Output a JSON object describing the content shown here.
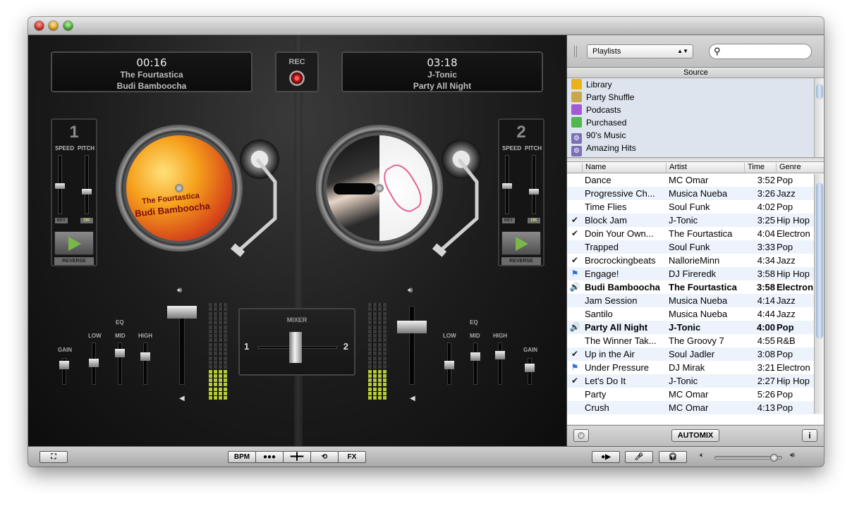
{
  "deck1": {
    "time": "00:16",
    "artist": "The Fourtastica",
    "title": "Budi Bamboocha",
    "number": "1",
    "label_line1": "The Fourtastica",
    "label_line2": "Budi Bamboocha"
  },
  "deck2": {
    "time": "03:18",
    "artist": "J-Tonic",
    "title": "Party All Night",
    "number": "2"
  },
  "rec_label": "REC",
  "deck_controls": {
    "speed": "SPEED",
    "pitch": "PITCH",
    "key": "KEY",
    "ok": "OK",
    "reverse": "REVERSE"
  },
  "eq": {
    "title": "EQ",
    "low": "LOW",
    "mid": "MID",
    "high": "HIGH",
    "gain": "GAIN"
  },
  "mixer": {
    "title": "MIXER",
    "left": "1",
    "right": "2"
  },
  "sidebar": {
    "source_select": "Playlists",
    "source_header": "Source",
    "sources": [
      {
        "label": "Library",
        "icon": "library-icon",
        "color": "#e8b21c"
      },
      {
        "label": "Party Shuffle",
        "icon": "party-shuffle-icon",
        "color": "#c9a84a"
      },
      {
        "label": "Podcasts",
        "icon": "podcasts-icon",
        "color": "#a35ad6"
      },
      {
        "label": "Purchased",
        "icon": "purchased-icon",
        "color": "#4fb84f"
      },
      {
        "label": "90’s Music",
        "icon": "smart-playlist-icon",
        "color": "#7a6fb8"
      },
      {
        "label": "Amazing Hits",
        "icon": "smart-playlist-icon",
        "color": "#7a6fb8"
      }
    ],
    "columns": {
      "name": "Name",
      "artist": "Artist",
      "time": "Time",
      "genre": "Genre"
    },
    "rows": [
      {
        "mark": "",
        "name": "Dance",
        "artist": "MC Omar",
        "time": "3:52",
        "genre": "Pop"
      },
      {
        "mark": "",
        "name": "Progressive Ch...",
        "artist": "Musica Nueba",
        "time": "3:26",
        "genre": "Jazz"
      },
      {
        "mark": "",
        "name": "Time Flies",
        "artist": "Soul Funk",
        "time": "4:02",
        "genre": "Pop"
      },
      {
        "mark": "✔",
        "name": "Block Jam",
        "artist": "J-Tonic",
        "time": "3:25",
        "genre": "Hip Hop"
      },
      {
        "mark": "✔",
        "name": "Doin Your Own...",
        "artist": "The Fourtastica",
        "time": "4:04",
        "genre": "Electron"
      },
      {
        "mark": "",
        "name": "Trapped",
        "artist": "Soul Funk",
        "time": "3:33",
        "genre": "Pop"
      },
      {
        "mark": "✔",
        "name": "Brocrockingbeats",
        "artist": "NallorieMinn",
        "time": "4:34",
        "genre": "Jazz"
      },
      {
        "mark": "⚑",
        "name": "Engage!",
        "artist": "DJ Fireredk",
        "time": "3:58",
        "genre": "Hip Hop"
      },
      {
        "mark": "🔊",
        "name": "Budi Bamboocha",
        "artist": "The Fourtastica",
        "time": "3:58",
        "genre": "Electron"
      },
      {
        "mark": "",
        "name": "Jam Session",
        "artist": "Musica Nueba",
        "time": "4:14",
        "genre": "Jazz"
      },
      {
        "mark": "",
        "name": "Santilo",
        "artist": "Musica Nueba",
        "time": "4:44",
        "genre": "Jazz"
      },
      {
        "mark": "🔊",
        "name": "Party All Night",
        "artist": "J-Tonic",
        "time": "4:00",
        "genre": "Pop"
      },
      {
        "mark": "",
        "name": "The Winner Tak...",
        "artist": "The Groovy 7",
        "time": "4:55",
        "genre": "R&B"
      },
      {
        "mark": "✔",
        "name": "Up in the Air",
        "artist": "Soul Jadler",
        "time": "3:08",
        "genre": "Pop"
      },
      {
        "mark": "⚑",
        "name": "Under Pressure",
        "artist": "DJ Mirak",
        "time": "3:21",
        "genre": "Electron"
      },
      {
        "mark": "✔",
        "name": "Let's Do It",
        "artist": "J-Tonic",
        "time": "2:27",
        "genre": "Hip Hop"
      },
      {
        "mark": "",
        "name": "Party",
        "artist": "MC Omar",
        "time": "5:26",
        "genre": "Pop"
      },
      {
        "mark": "",
        "name": "Crush",
        "artist": "MC Omar",
        "time": "4:13",
        "genre": "Pop"
      }
    ],
    "automix": "AUTOMIX",
    "info": "i"
  },
  "toolbar": {
    "bpm": "BPM",
    "fx": "FX"
  },
  "volume": 0.9
}
